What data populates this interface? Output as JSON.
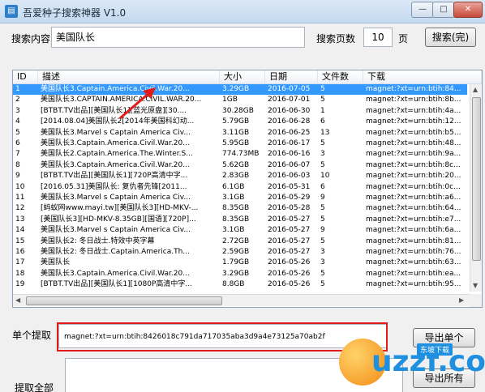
{
  "window": {
    "title": "吾爱种子搜索神器 V1.0",
    "min": "—",
    "max": "□",
    "close": "✕"
  },
  "search": {
    "label": "搜索内容",
    "value": "美国队长",
    "pages_label": "搜索页数",
    "pages_value": "10",
    "pages_unit": "页",
    "button": "搜索(完)"
  },
  "table": {
    "columns": [
      "ID",
      "描述",
      "大小",
      "日期",
      "文件数",
      "下载"
    ],
    "rows": [
      [
        "1",
        "美国队长3.Captain.America.Civil.War.20...",
        "3.29GB",
        "2016-07-05",
        "5",
        "magnet:?xt=urn:btih:84..."
      ],
      [
        "2",
        "美国队长3.CAPTAIN.AMERICA.CIVIL.WAR.20...",
        "1GB",
        "2016-07-01",
        "5",
        "magnet:?xt=urn:btih:8b..."
      ],
      [
        "3",
        "[BTBT.TV出品][美国队长1][蓝光原盘][30....",
        "30.28GB",
        "2016-06-30",
        "1",
        "magnet:?xt=urn:btih:4a..."
      ],
      [
        "4",
        "[2014.08.04]美国队长2[2014年美国科幻动...",
        "5.79GB",
        "2016-06-28",
        "6",
        "magnet:?xt=urn:btih:12..."
      ],
      [
        "5",
        "美国队长3.Marvel s Captain America Civ...",
        "3.11GB",
        "2016-06-25",
        "13",
        "magnet:?xt=urn:btih:b5..."
      ],
      [
        "6",
        "美国队长3.Captain.America.Civil.War.20...",
        "5.95GB",
        "2016-06-17",
        "5",
        "magnet:?xt=urn:btih:48..."
      ],
      [
        "7",
        "美国队长2.Captain.America.The.Winter.S...",
        "774.73MB",
        "2016-06-16",
        "3",
        "magnet:?xt=urn:btih:9a..."
      ],
      [
        "8",
        "美国队长3.Captain.America.Civil.War.20...",
        "5.62GB",
        "2016-06-07",
        "5",
        "magnet:?xt=urn:btih:8c..."
      ],
      [
        "9",
        "[BTBT.TV出品][美国队长1][720P高清中字...",
        "2.83GB",
        "2016-06-03",
        "10",
        "magnet:?xt=urn:btih:20..."
      ],
      [
        "10",
        "[2016.05.31]美国队长: 复仇者先锋[2011...",
        "6.1GB",
        "2016-05-31",
        "6",
        "magnet:?xt=urn:btih:0c..."
      ],
      [
        "11",
        "美国队长3.Marvel s Captain America Civ...",
        "3.1GB",
        "2016-05-29",
        "9",
        "magnet:?xt=urn:btih:a6..."
      ],
      [
        "12",
        "[蚂蚁网www.mayi.tw][美国队长3][HD-MKV-...",
        "8.35GB",
        "2016-05-28",
        "5",
        "magnet:?xt=urn:btih:64..."
      ],
      [
        "13",
        "[美国队长3][HD-MKV-8.35GB][国语][720P]...",
        "8.35GB",
        "2016-05-27",
        "5",
        "magnet:?xt=urn:btih:e7..."
      ],
      [
        "14",
        "美国队长3.Marvel s Captain America Civ...",
        "3.1GB",
        "2016-05-27",
        "9",
        "magnet:?xt=urn:btih:6a..."
      ],
      [
        "15",
        "美国队长2: 冬日战士.特效中英字幕",
        "2.72GB",
        "2016-05-27",
        "5",
        "magnet:?xt=urn:btih:81..."
      ],
      [
        "16",
        "美国队长2: 冬日战士.Captain.America.Th...",
        "2.59GB",
        "2016-05-27",
        "3",
        "magnet:?xt=urn:btih:76..."
      ],
      [
        "17",
        "美国队长",
        "1.79GB",
        "2016-05-26",
        "3",
        "magnet:?xt=urn:btih:63..."
      ],
      [
        "18",
        "美国队长3.Captain.America.Civil.War.20...",
        "3.29GB",
        "2016-05-26",
        "5",
        "magnet:?xt=urn:btih:ea..."
      ],
      [
        "19",
        "[BTBT.TV出品][美国队长1][1080P高清中字...",
        "8.8GB",
        "2016-05-26",
        "5",
        "magnet:?xt=urn:btih:95..."
      ]
    ]
  },
  "single": {
    "label": "单个提取",
    "value": "magnet:?xt=urn:btih:8426018c791da717035aba3d9a4e73125a70ab2f",
    "button": "导出单个"
  },
  "all": {
    "label": "提取全部",
    "button": "导出所有"
  },
  "watermark": {
    "text": "uzzf.com",
    "badge": "东坡下载"
  },
  "colors": {
    "selection": "#3399ff",
    "highlight": "#e21b1b"
  }
}
